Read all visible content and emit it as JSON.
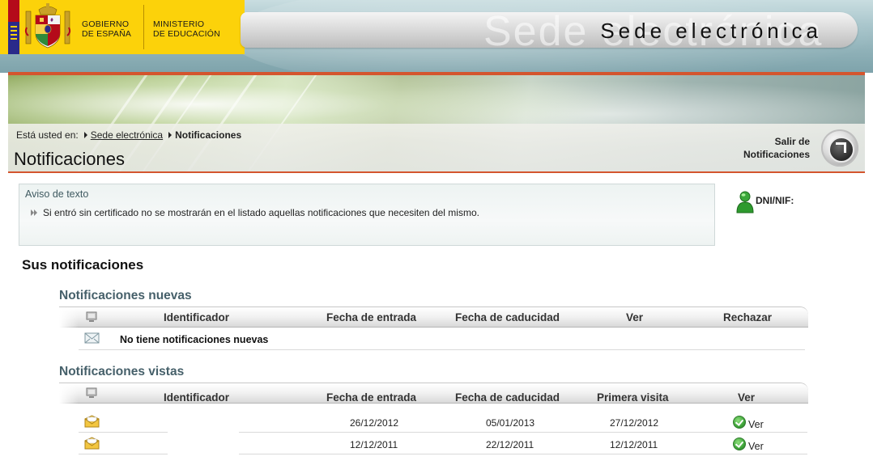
{
  "header": {
    "gov_line1": "GOBIERNO",
    "gov_line2": "DE ESPAÑA",
    "ministry_line1": "MINISTERIO",
    "ministry_line2": "DE EDUCACIÓN",
    "portal_title": "Sede electrónica",
    "portal_watermark": "Sede electrónica"
  },
  "breadcrumb": {
    "prefix": "Está usted en:",
    "items": [
      {
        "label": "Sede electrónica",
        "link": true
      },
      {
        "label": "Notificaciones",
        "link": false
      }
    ]
  },
  "page_title": "Notificaciones",
  "logout": {
    "line1": "Salir de",
    "line2": "Notificaciones"
  },
  "notice": {
    "title": "Aviso de texto",
    "text": "Si entró sin certificado no se mostrarán en el listado aquellas notificaciones que necesiten del mismo."
  },
  "user": {
    "label": "DNI/NIF:"
  },
  "notifications": {
    "section_title": "Sus notificaciones",
    "new": {
      "title": "Notificaciones nuevas",
      "columns": [
        "Identificador",
        "Fecha de entrada",
        "Fecha de caducidad",
        "Ver",
        "Rechazar"
      ],
      "empty_message": "No tiene notificaciones nuevas"
    },
    "viewed": {
      "title": "Notificaciones vistas",
      "columns": [
        "Identificador",
        "Fecha de entrada",
        "Fecha de caducidad",
        "Primera visita",
        "Ver"
      ],
      "rows": [
        {
          "identifier": "",
          "entry_date": "26/12/2012",
          "expiry_date": "05/01/2013",
          "first_visit": "27/12/2012",
          "view_label": "Ver"
        },
        {
          "identifier": "",
          "entry_date": "12/12/2011",
          "expiry_date": "22/12/2011",
          "first_visit": "12/12/2011",
          "view_label": "Ver"
        }
      ]
    }
  },
  "colors": {
    "accent_orange": "#d4552e",
    "logo_yellow": "#fcd20a",
    "heading_teal": "#46606a"
  }
}
